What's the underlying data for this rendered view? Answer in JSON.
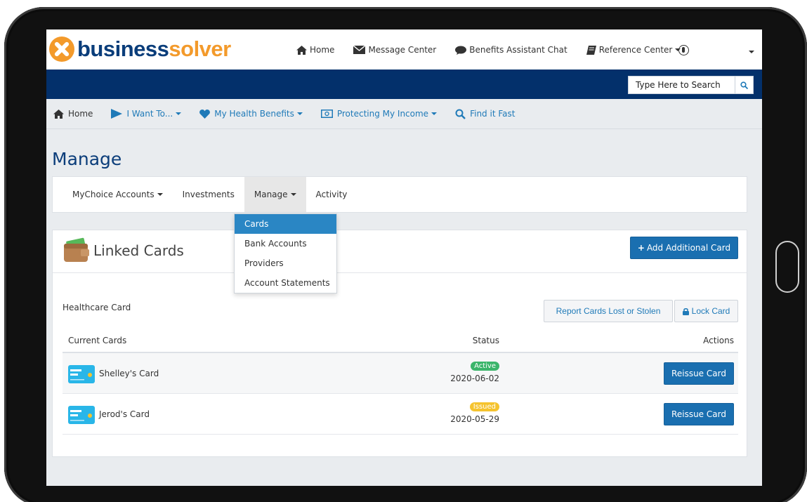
{
  "brand": {
    "logo_part1": "business",
    "logo_part2": "solver"
  },
  "topnav": {
    "home": "Home",
    "message_center": "Message Center",
    "chat": "Benefits Assistant Chat",
    "reference": "Reference Center"
  },
  "search": {
    "placeholder": "Type Here to Search"
  },
  "mainnav": {
    "home": "Home",
    "i_want_to": "I Want To...",
    "health": "My Health Benefits",
    "income": "Protecting My Income",
    "find": "Find it Fast"
  },
  "page": {
    "title": "Manage"
  },
  "subnav": {
    "mychoice": "MyChoice Accounts",
    "investments": "Investments",
    "manage": "Manage",
    "activity": "Activity"
  },
  "dropdown": {
    "items": [
      "Cards",
      "Bank Accounts",
      "Providers",
      "Account Statements"
    ]
  },
  "panel": {
    "title": "Linked Cards",
    "add_button": "Add Additional Card",
    "section_label": "Healthcare Card",
    "report_button": "Report Cards Lost or Stolen",
    "lock_button": "Lock Card"
  },
  "table": {
    "headers": {
      "current": "Current Cards",
      "status": "Status",
      "actions": "Actions"
    },
    "rows": [
      {
        "name": "Shelley's Card",
        "status": "Active",
        "date": "2020-06-02",
        "action": "Reissue Card"
      },
      {
        "name": "Jerod's Card",
        "status": "Issued",
        "date": "2020-05-29",
        "action": "Reissue Card"
      }
    ]
  },
  "colors": {
    "brand_navy": "#03306b",
    "brand_orange": "#f39a2b",
    "link_blue": "#1f7ab8",
    "primary_button": "#1a6fb0",
    "active_badge": "#3bb56b",
    "issued_badge": "#f5c32e"
  }
}
